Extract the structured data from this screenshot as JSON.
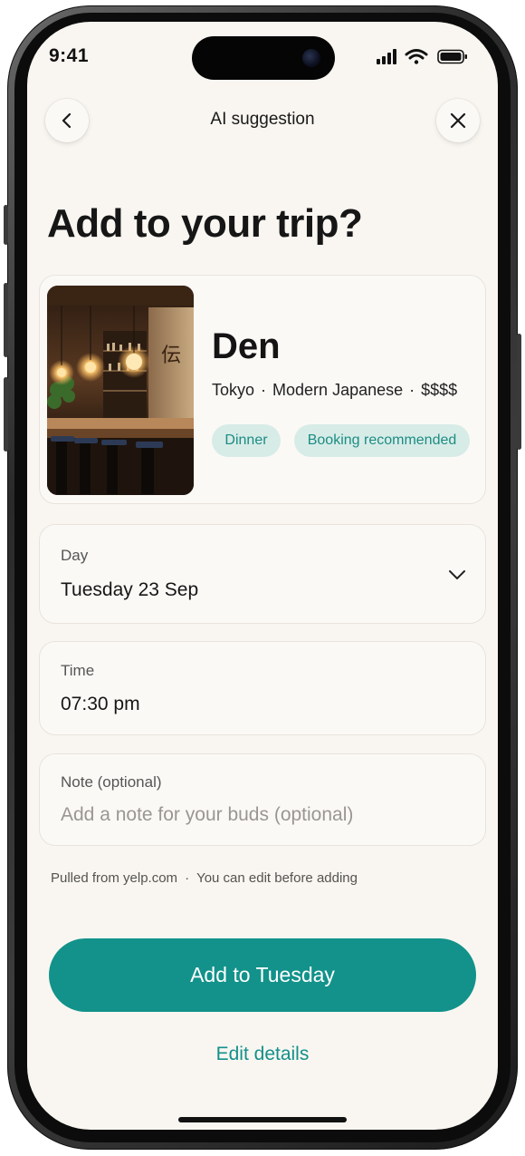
{
  "status_bar": {
    "time": "9:41"
  },
  "nav": {
    "title": "AI suggestion"
  },
  "headline": "Add to your trip?",
  "place": {
    "name": "Den",
    "city": "Tokyo",
    "cuisine": "Modern Japanese",
    "price": "$$$$",
    "separator": "·",
    "thumbnail_sign": "伝",
    "tags": [
      "Dinner",
      "Booking recommended"
    ]
  },
  "form": {
    "day": {
      "label": "Day",
      "value": "Tuesday 23 Sep"
    },
    "time": {
      "label": "Time",
      "value": "07:30 pm"
    },
    "note": {
      "label": "Note (optional)",
      "placeholder": "Add a note for your buds (optional)"
    }
  },
  "source": {
    "text": "Pulled from yelp.com",
    "separator": "·",
    "hint": "You can edit before adding"
  },
  "actions": {
    "primary_label": "Add to Tuesday",
    "secondary_label": "Edit details"
  },
  "colors": {
    "accent": "#12928a",
    "chip_bg": "#d8ece7",
    "screen_bg": "#f9f6f1"
  }
}
